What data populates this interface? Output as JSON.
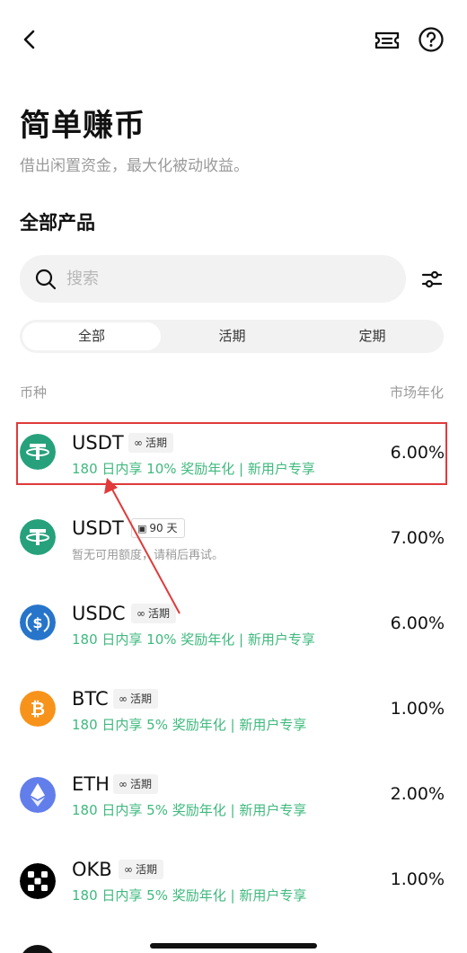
{
  "header": {
    "back_icon": "chevron-left-icon",
    "ticket_icon": "ticket-icon",
    "help_icon": "question-circle-icon"
  },
  "page": {
    "title": "简单赚币",
    "subtitle": "借出闲置资金，最大化被动收益。",
    "section_title": "全部产品"
  },
  "search": {
    "placeholder": "搜索"
  },
  "tabs": [
    {
      "label": "全部",
      "active": true
    },
    {
      "label": "活期",
      "active": false
    },
    {
      "label": "定期",
      "active": false
    }
  ],
  "columns": {
    "left": "币种",
    "right": "市场年化"
  },
  "products": [
    {
      "coin": "USDT",
      "badge": "活期",
      "badge_icon": "infinity-icon",
      "sub": "180 日内享 10% 奖励年化 | 新用户专享",
      "sub_type": "promo",
      "rate": "6.00%",
      "icon_color": "#26a17b"
    },
    {
      "coin": "USDT",
      "badge": "90 天",
      "badge_icon": "calendar-icon",
      "sub": "暂无可用额度，请稍后再试。",
      "sub_type": "note",
      "rate": "7.00%",
      "icon_color": "#26a17b"
    },
    {
      "coin": "USDC",
      "badge": "活期",
      "badge_icon": "infinity-icon",
      "sub": "180 日内享 10% 奖励年化 | 新用户专享",
      "sub_type": "promo",
      "rate": "6.00%",
      "icon_color": "#2775ca"
    },
    {
      "coin": "BTC",
      "badge": "活期",
      "badge_icon": "infinity-icon",
      "sub": "180 日内享 5% 奖励年化 | 新用户专享",
      "sub_type": "promo",
      "rate": "1.00%",
      "icon_color": "#f7931a"
    },
    {
      "coin": "ETH",
      "badge": "活期",
      "badge_icon": "infinity-icon",
      "sub": "180 日内享 5% 奖励年化 | 新用户专享",
      "sub_type": "promo",
      "rate": "2.00%",
      "icon_color": "#627eea"
    },
    {
      "coin": "OKB",
      "badge": "活期",
      "badge_icon": "infinity-icon",
      "sub": "180 日内享 5% 奖励年化 | 新用户专享",
      "sub_type": "promo",
      "rate": "1.00%",
      "icon_color": "#000000"
    }
  ],
  "annotation": {
    "highlight_color": "#e03a3a"
  },
  "colors": {
    "promo_green": "#3fb97e",
    "muted_gray": "#9a9a9a"
  }
}
